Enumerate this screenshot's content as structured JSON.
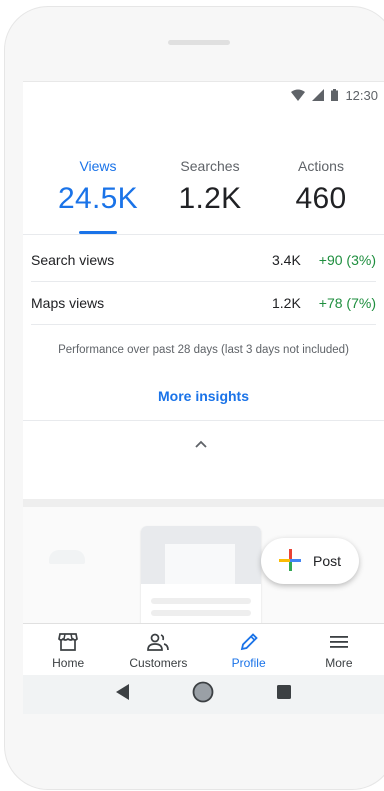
{
  "status_bar": {
    "time": "12:30"
  },
  "metrics": [
    {
      "label": "Views",
      "value": "24.5K",
      "active": true
    },
    {
      "label": "Searches",
      "value": "1.2K",
      "active": false
    },
    {
      "label": "Actions",
      "value": "460",
      "active": false
    }
  ],
  "rows": [
    {
      "name": "Search views",
      "value": "3.4K",
      "delta": "+90 (3%)"
    },
    {
      "name": "Maps views",
      "value": "1.2K",
      "delta": "+78 (7%)"
    }
  ],
  "note": "Performance over past 28 days (last 3 days not included)",
  "more_insights": "More insights",
  "fab": {
    "label": "Post"
  },
  "nav": [
    {
      "label": "Home",
      "icon": "store-icon"
    },
    {
      "label": "Customers",
      "icon": "people-icon"
    },
    {
      "label": "Profile",
      "icon": "pencil-icon",
      "active": true
    },
    {
      "label": "More",
      "icon": "menu-icon"
    }
  ],
  "colors": {
    "accent": "#1a73e8",
    "positive": "#1e8e3e"
  }
}
